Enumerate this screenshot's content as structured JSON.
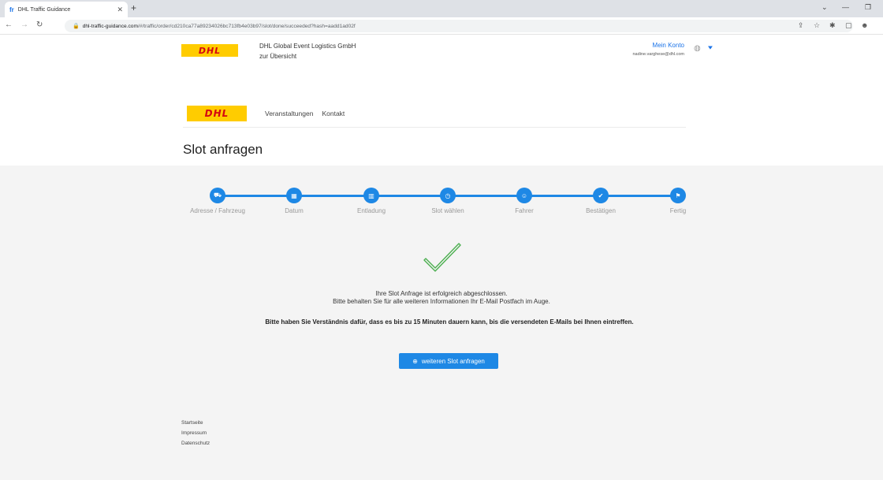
{
  "browser": {
    "tab_title": "DHL Traffic Guidance",
    "tab_favicon": "fr",
    "url_host": "dhl-traffic-guidance.com",
    "url_path": "/#/traffic/order/cd210ca77a89234026bc713fb4e03b97/slot/done/succeeded?hash=aadd1ad02f"
  },
  "header": {
    "logo_text": "DHL",
    "company_name": "DHL Global Event Logistics GmbH",
    "overview_link": "zur Übersicht",
    "account_label": "Mein Konto",
    "account_email": "nadine.varghese@dhl.com"
  },
  "nav": {
    "logo_text": "DHL",
    "items": [
      "Veranstaltungen",
      "Kontakt"
    ]
  },
  "page_title": "Slot anfragen",
  "steps": [
    {
      "label": "Adresse / Fahrzeug",
      "icon": "truck-icon",
      "glyph": "⛟"
    },
    {
      "label": "Datum",
      "icon": "calendar-icon",
      "glyph": "▦"
    },
    {
      "label": "Entladung",
      "icon": "unloading-icon",
      "glyph": "▥"
    },
    {
      "label": "Slot wählen",
      "icon": "clock-icon",
      "glyph": "◷"
    },
    {
      "label": "Fahrer",
      "icon": "driver-icon",
      "glyph": "☺"
    },
    {
      "label": "Bestätigen",
      "icon": "confirm-icon",
      "glyph": "✔"
    },
    {
      "label": "Fertig",
      "icon": "flag-icon",
      "glyph": "⚑"
    }
  ],
  "success": {
    "line1": "Ihre Slot Anfrage ist erfolgreich abgeschlossen.",
    "line2": "Bitte behalten Sie für alle weiteren Informationen Ihr E-Mail Postfach im Auge.",
    "note": "Bitte haben Sie Verständnis dafür, dass es bis zu 15 Minuten dauern kann, bis die versendeten E-Mails bei Ihnen eintreffen."
  },
  "cta_label": "weiteren Slot anfragen",
  "footer": {
    "links": [
      "Startseite",
      "Impressum",
      "Datenschutz"
    ]
  },
  "colors": {
    "accent": "#1e88e5",
    "dhl_yellow": "#ffcc00",
    "dhl_red": "#d40511",
    "success_green": "#4caf50"
  }
}
